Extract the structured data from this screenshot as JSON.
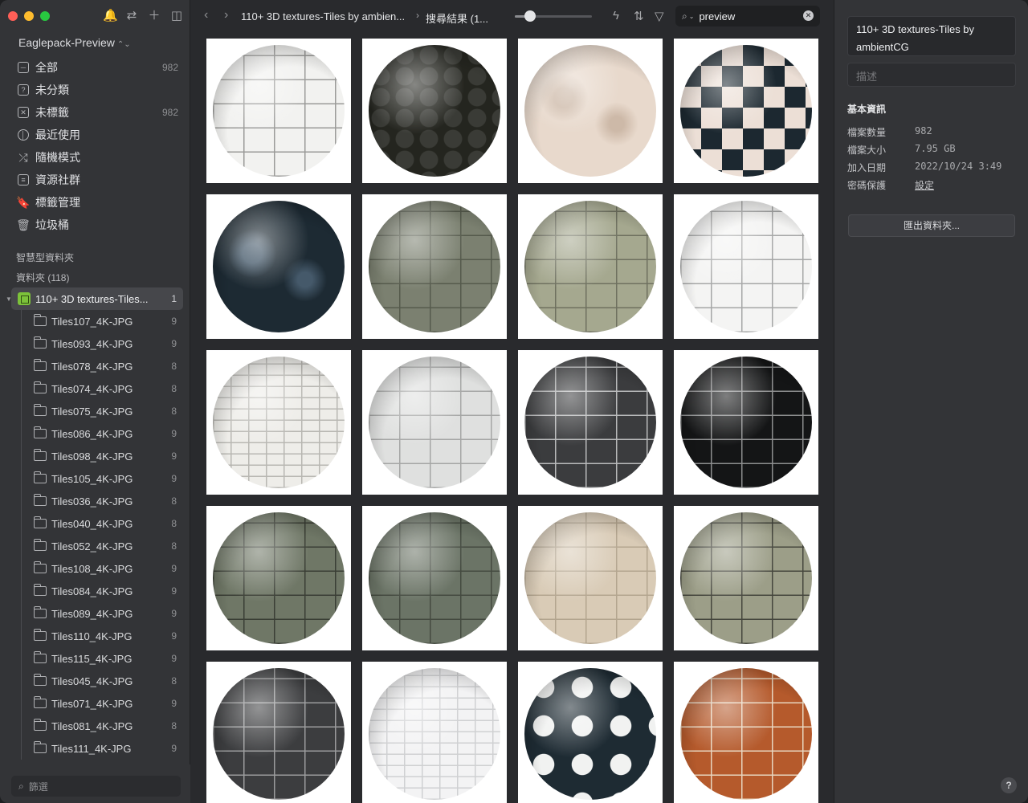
{
  "window": {
    "traffic": {
      "close": "#ff5f57",
      "minimize": "#febc2e",
      "zoom": "#28c840"
    }
  },
  "sidebar": {
    "library_name": "Eaglepack-Preview",
    "nav": [
      {
        "label": "全部",
        "count": "982",
        "icon": "inbox-icon"
      },
      {
        "label": "未分類",
        "count": "",
        "icon": "question-box-icon"
      },
      {
        "label": "未標籤",
        "count": "982",
        "icon": "untagged-icon"
      },
      {
        "label": "最近使用",
        "count": "",
        "icon": "clock-icon"
      },
      {
        "label": "隨機模式",
        "count": "",
        "icon": "shuffle-icon"
      },
      {
        "label": "資源社群",
        "count": "",
        "icon": "community-icon"
      },
      {
        "label": "標籤管理",
        "count": "",
        "icon": "bookmark-icon"
      },
      {
        "label": "垃圾桶",
        "count": "",
        "icon": "trash-icon"
      }
    ],
    "smart_folders_label": "智慧型資料夾",
    "folders_label": "資料夾 (118)",
    "root_folder": {
      "label": "110+ 3D textures-Tiles...",
      "count": "1"
    },
    "subfolders": [
      {
        "label": "Tiles107_4K-JPG",
        "count": "9"
      },
      {
        "label": "Tiles093_4K-JPG",
        "count": "9"
      },
      {
        "label": "Tiles078_4K-JPG",
        "count": "8"
      },
      {
        "label": "Tiles074_4K-JPG",
        "count": "8"
      },
      {
        "label": "Tiles075_4K-JPG",
        "count": "8"
      },
      {
        "label": "Tiles086_4K-JPG",
        "count": "9"
      },
      {
        "label": "Tiles098_4K-JPG",
        "count": "9"
      },
      {
        "label": "Tiles105_4K-JPG",
        "count": "9"
      },
      {
        "label": "Tiles036_4K-JPG",
        "count": "8"
      },
      {
        "label": "Tiles040_4K-JPG",
        "count": "8"
      },
      {
        "label": "Tiles052_4K-JPG",
        "count": "8"
      },
      {
        "label": "Tiles108_4K-JPG",
        "count": "9"
      },
      {
        "label": "Tiles084_4K-JPG",
        "count": "9"
      },
      {
        "label": "Tiles089_4K-JPG",
        "count": "9"
      },
      {
        "label": "Tiles110_4K-JPG",
        "count": "9"
      },
      {
        "label": "Tiles115_4K-JPG",
        "count": "9"
      },
      {
        "label": "Tiles045_4K-JPG",
        "count": "8"
      },
      {
        "label": "Tiles071_4K-JPG",
        "count": "9"
      },
      {
        "label": "Tiles081_4K-JPG",
        "count": "8"
      },
      {
        "label": "Tiles111_4K-JPG",
        "count": "9"
      }
    ],
    "filter_placeholder": "篩選"
  },
  "toolbar": {
    "breadcrumb_folder": "110+ 3D textures-Tiles by ambien...",
    "breadcrumb_result": "搜尋結果 (1...",
    "thumb_size_fraction": 0.2,
    "search_value": "preview"
  },
  "grid": {
    "thumbnails": [
      {
        "base": "#f2f2f0",
        "line": "#9a9a98",
        "lines": true
      },
      {
        "base": "#3a3b36",
        "line": "#5a5c52",
        "lines": false,
        "pattern": "cobble"
      },
      {
        "base": "#e8d9cc",
        "line": "#cdb9a8",
        "lines": false
      },
      {
        "base": "#ecdfd6",
        "line": "#1c2830",
        "lines": false,
        "pattern": "checker"
      },
      {
        "base": "#1d2a33",
        "line": "#45596a",
        "lines": false
      },
      {
        "base": "#7b8070",
        "line": "#555a4c",
        "lines": true
      },
      {
        "base": "#a5a88f",
        "line": "#6e705f",
        "lines": true
      },
      {
        "base": "#f4f4f3",
        "line": "#a5a6a6",
        "lines": true
      },
      {
        "base": "#eeede9",
        "line": "#b8b7b2",
        "lines": true,
        "dense": true
      },
      {
        "base": "#dfe0df",
        "line": "#a5a6a5",
        "lines": true
      },
      {
        "base": "#3b3c3e",
        "line": "#b9babb",
        "lines": true
      },
      {
        "base": "#141516",
        "line": "#8d8e8f",
        "lines": true
      },
      {
        "base": "#6f7766",
        "line": "#3a3e35",
        "lines": true
      },
      {
        "base": "#6b7466",
        "line": "#444a40",
        "lines": true
      },
      {
        "base": "#d9cbb6",
        "line": "#b3a58f",
        "lines": true
      },
      {
        "base": "#9c9e88",
        "line": "#45463d",
        "lines": true
      },
      {
        "base": "#3c3d3f",
        "line": "#9b9c9d",
        "lines": true
      },
      {
        "base": "#f3f3f4",
        "line": "#cfd0d2",
        "lines": true,
        "dense": true
      },
      {
        "base": "#f1f2f1",
        "line": "#1e2b33",
        "lines": false,
        "pattern": "star"
      },
      {
        "base": "#b55a2c",
        "line": "#e8d6bf",
        "lines": true
      }
    ]
  },
  "inspector": {
    "title": "110+ 3D textures-Tiles by ambientCG",
    "description_placeholder": "描述",
    "section_title": "基本資訊",
    "rows": [
      {
        "key": "檔案數量",
        "value": "982"
      },
      {
        "key": "檔案大小",
        "value": "7.95 GB"
      },
      {
        "key": "加入日期",
        "value": "2022/10/24 3:49"
      },
      {
        "key": "密碼保護",
        "value": "設定"
      }
    ],
    "export_label": "匯出資料夾...",
    "help_label": "?"
  }
}
